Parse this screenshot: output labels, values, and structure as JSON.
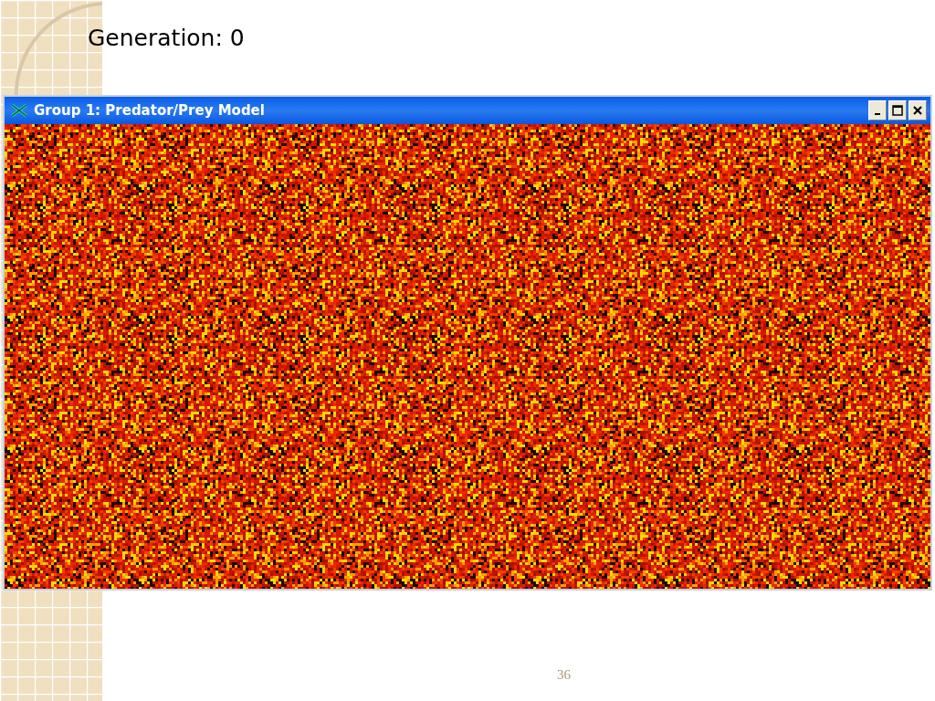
{
  "slide": {
    "heading": "Generation: 0",
    "page_number": "36"
  },
  "window": {
    "title": "Group 1: Predator/Prey Model"
  }
}
